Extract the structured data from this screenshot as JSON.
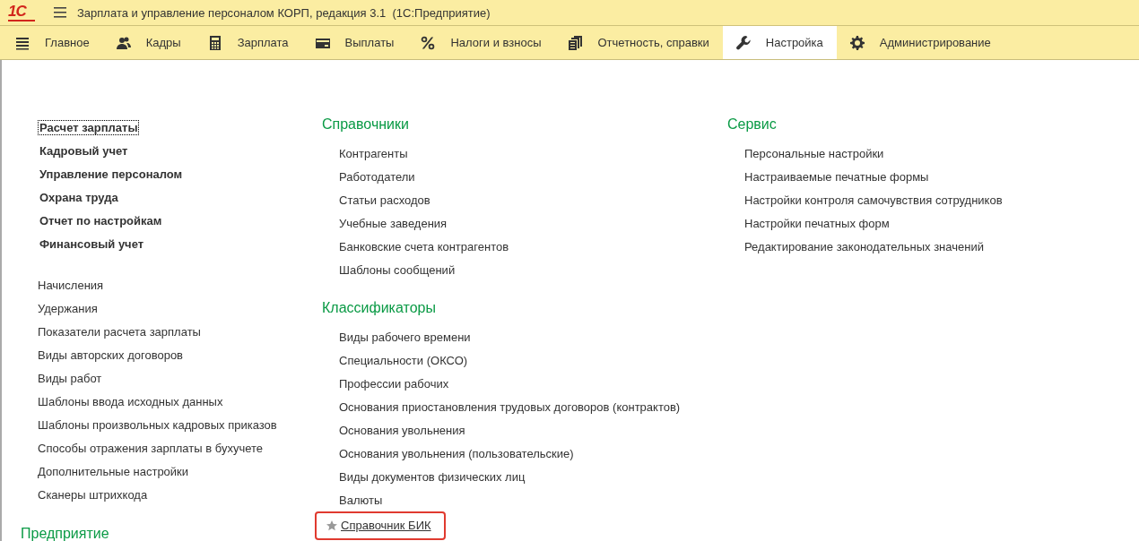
{
  "window": {
    "logo": "1С",
    "title": "Зарплата и управление персоналом КОРП, редакция 3.1  (1С:Предприятие)"
  },
  "tabs": [
    {
      "label": "Главное",
      "selected": false
    },
    {
      "label": "Кадры",
      "selected": false
    },
    {
      "label": "Зарплата",
      "selected": false
    },
    {
      "label": "Выплаты",
      "selected": false
    },
    {
      "label": "Налоги и взносы",
      "selected": false
    },
    {
      "label": "Отчетность, справки",
      "selected": false
    },
    {
      "label": "Настройка",
      "selected": true
    },
    {
      "label": "Администрирование",
      "selected": false
    }
  ],
  "left": {
    "main_links": [
      {
        "label": "Расчет зарплаты",
        "focused": true
      },
      {
        "label": "Кадровый учет",
        "focused": false
      },
      {
        "label": "Управление персоналом",
        "focused": false
      },
      {
        "label": "Охрана труда",
        "focused": false
      },
      {
        "label": "Отчет по настройкам",
        "focused": false
      },
      {
        "label": "Финансовый учет",
        "focused": false
      }
    ],
    "links": [
      "Начисления",
      "Удержания",
      "Показатели расчета зарплаты",
      "Виды авторских договоров",
      "Виды работ",
      "Шаблоны ввода исходных данных",
      "Шаблоны произвольных кадровых приказов",
      "Способы отражения зарплаты в бухучете",
      "Дополнительные настройки",
      "Сканеры штрихкода"
    ],
    "next_section": "Предприятие"
  },
  "sections": [
    {
      "title": "Справочники",
      "items": [
        {
          "label": "Контрагенты",
          "favorite": false,
          "highlighted": false
        },
        {
          "label": "Работодатели",
          "favorite": false,
          "highlighted": false
        },
        {
          "label": "Статьи расходов",
          "favorite": false,
          "highlighted": false
        },
        {
          "label": "Учебные заведения",
          "favorite": false,
          "highlighted": false
        },
        {
          "label": "Банковские счета контрагентов",
          "favorite": false,
          "highlighted": false
        },
        {
          "label": "Шаблоны сообщений",
          "favorite": false,
          "highlighted": false
        }
      ]
    },
    {
      "title": "Классификаторы",
      "items": [
        {
          "label": "Виды рабочего времени",
          "favorite": false,
          "highlighted": false
        },
        {
          "label": "Специальности (ОКСО)",
          "favorite": false,
          "highlighted": false
        },
        {
          "label": "Профессии рабочих",
          "favorite": false,
          "highlighted": false
        },
        {
          "label": "Основания приостановления трудовых договоров (контрактов)",
          "favorite": false,
          "highlighted": false
        },
        {
          "label": "Основания увольнения",
          "favorite": false,
          "highlighted": false
        },
        {
          "label": "Основания увольнения (пользовательские)",
          "favorite": false,
          "highlighted": false
        },
        {
          "label": "Виды документов физических лиц",
          "favorite": false,
          "highlighted": false
        },
        {
          "label": "Валюты",
          "favorite": false,
          "highlighted": false
        },
        {
          "label": "Справочник БИК",
          "favorite": true,
          "highlighted": true
        }
      ]
    },
    {
      "title": "Сервис",
      "items": [
        {
          "label": "Персональные настройки",
          "favorite": false,
          "highlighted": false
        },
        {
          "label": "Настраиваемые печатные формы",
          "favorite": false,
          "highlighted": false
        },
        {
          "label": "Настройки контроля самочувствия сотрудников",
          "favorite": false,
          "highlighted": false
        },
        {
          "label": "Настройки печатных форм",
          "favorite": false,
          "highlighted": false
        },
        {
          "label": "Редактирование законодательных значений",
          "favorite": false,
          "highlighted": false
        }
      ]
    }
  ]
}
